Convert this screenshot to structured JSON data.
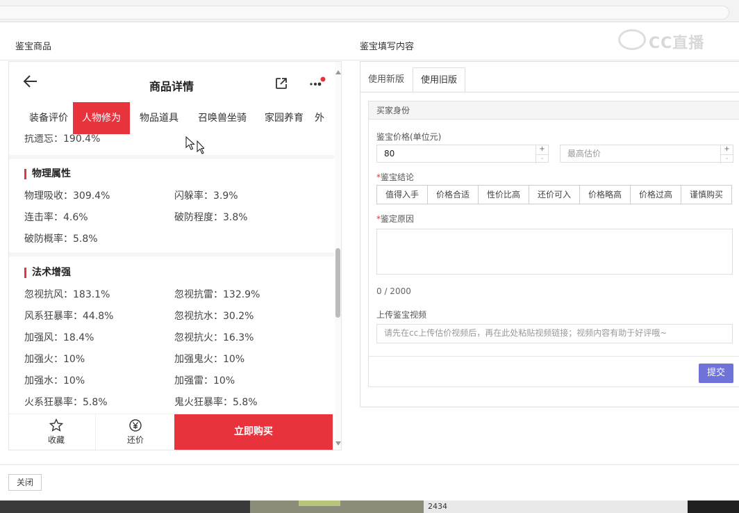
{
  "dialog": {
    "left_label": "鉴宝商品",
    "right_label": "鉴宝填写内容",
    "watermark": "CC直播",
    "close_label": "关闭"
  },
  "phone": {
    "title": "商品详情",
    "tabs": [
      "装备评价",
      "人物修为",
      "物品道具",
      "召唤兽坐骑",
      "家园养育",
      "外"
    ],
    "active_tab": 1,
    "cut_line": "抗遗忘：190.4%",
    "sections": [
      {
        "title": "物理属性",
        "rows": [
          [
            "物理吸收：309.4%",
            "闪躲率：3.9%"
          ],
          [
            "连击率：4.6%",
            "破防程度：3.8%"
          ],
          [
            "破防概率：5.8%",
            ""
          ]
        ]
      },
      {
        "title": "法术增强",
        "rows": [
          [
            "忽视抗风：183.1%",
            "忽视抗雷：132.9%"
          ],
          [
            "风系狂暴率：44.8%",
            "忽视抗水：30.2%"
          ],
          [
            "加强风：18.4%",
            "忽视抗火：16.3%"
          ],
          [
            "加强火：10%",
            "加强鬼火：10%"
          ],
          [
            "加强水：10%",
            "加强雷：10%"
          ],
          [
            "火系狂暴率：5.8%",
            "鬼火狂暴率：5.8%"
          ]
        ]
      }
    ],
    "bottom": {
      "favorite_label": "收藏",
      "bargain_label": "还价",
      "buy_label": "立即购买"
    },
    "accent": "#e8323c"
  },
  "form": {
    "tabs": [
      "使用新版",
      "使用旧版"
    ],
    "active_tab": 1,
    "card_title": "买家身份",
    "price_label": "鉴宝价格(单位元)",
    "price_value": "80",
    "max_price_placeholder": "最高估价",
    "verdict_label": "鉴宝结论",
    "verdict_options": [
      "值得入手",
      "价格合适",
      "性价比高",
      "还价可入",
      "价格略高",
      "价格过高",
      "谨慎购买"
    ],
    "reason_label": "鉴定原因",
    "counter": "0 / 2000",
    "video_label": "上传鉴宝视频",
    "video_placeholder": "请先在cc上传估价视频后，再在此处粘贴视频链接；视频内容有助于好评哦~",
    "submit_label": "提交",
    "submit_color": "#6f72d8"
  },
  "taskbar": {
    "cell_text": "2434"
  }
}
